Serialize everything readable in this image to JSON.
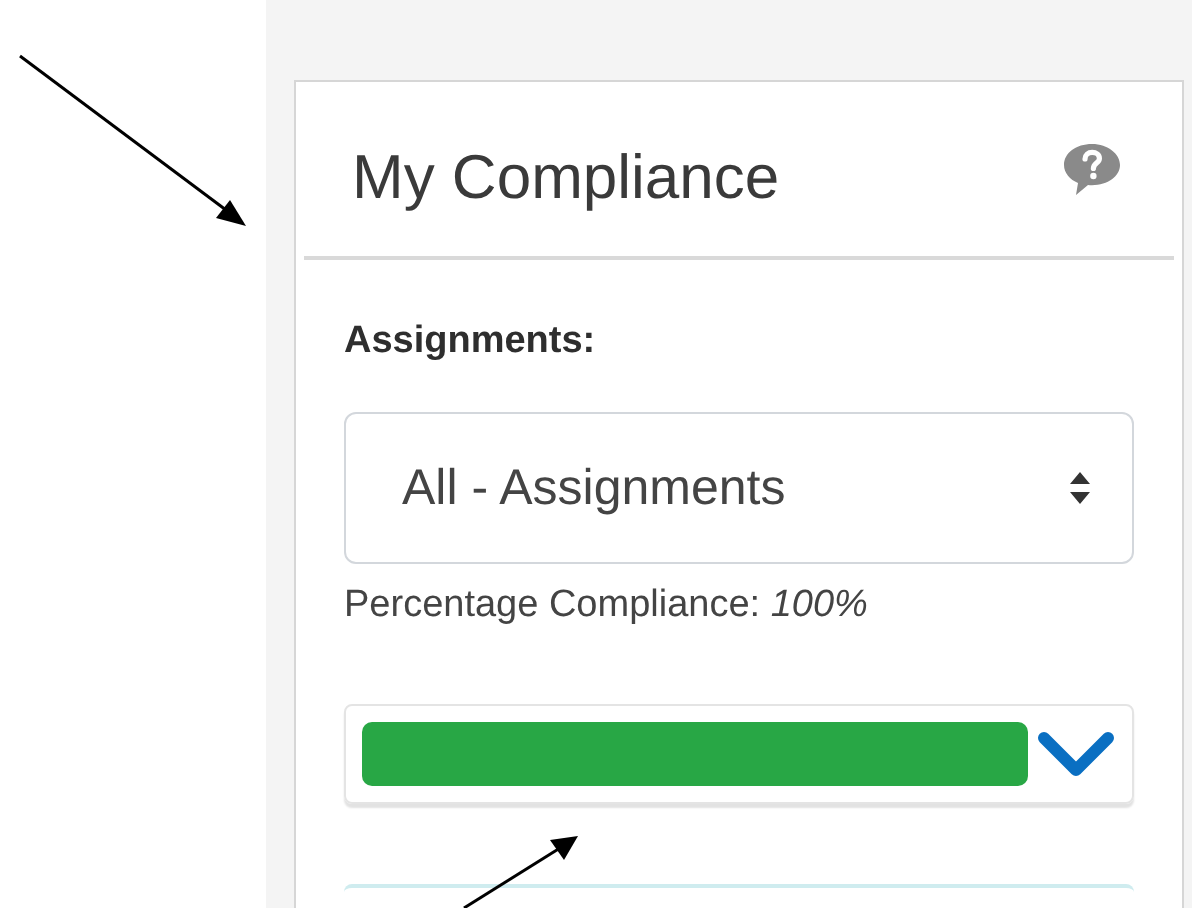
{
  "card": {
    "title": "My Compliance",
    "assignments": {
      "label": "Assignments:",
      "value": "All - Assignments"
    },
    "percentage": {
      "label": "Percentage Compliance:",
      "value": "100%"
    },
    "compliance_bar": {
      "expanded": false
    }
  }
}
